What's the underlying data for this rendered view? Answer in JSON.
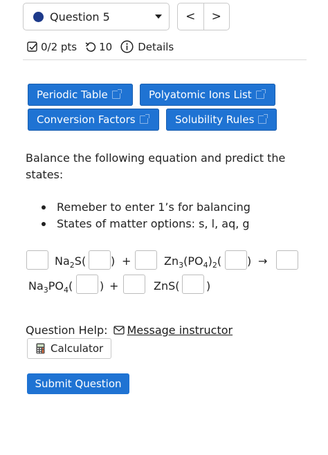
{
  "question_nav": {
    "selected": "Question 5",
    "prev_label": "<",
    "next_label": ">"
  },
  "meta": {
    "points": "0/2 pts",
    "attempts": "10",
    "details_label": "Details"
  },
  "resources": [
    {
      "label": "Periodic Table"
    },
    {
      "label": "Polyatomic Ions List"
    },
    {
      "label": "Conversion Factors"
    },
    {
      "label": "Solubility Rules"
    }
  ],
  "question": {
    "prompt_line1": "Balance the following equation and predict the",
    "prompt_line2": "states:",
    "bullets": [
      "Remeber to enter 1’s for balancing",
      "States of matter options: s, l, aq, g"
    ]
  },
  "equation": {
    "plus": "+",
    "arrow": "→",
    "close_paren": ")",
    "open_paren": "(",
    "na2s": {
      "base": "Na",
      "sub": "2",
      "tail": "S"
    },
    "zn3po42": {
      "base": "Zn",
      "sub1": "3",
      "mid": "(PO",
      "sub2": "4",
      "close": ")",
      "sub3": "2"
    },
    "na3po4": {
      "base": "Na",
      "sub1": "3",
      "mid": "PO",
      "sub2": "4"
    },
    "zns": {
      "text": "ZnS"
    }
  },
  "help": {
    "label": "Question Help:",
    "message_link": "Message instructor",
    "calculator_label": "Calculator"
  },
  "submit_label": "Submit Question",
  "colors": {
    "accent_blue": "#1f73d3",
    "nav_dot": "#1d3a8a"
  }
}
